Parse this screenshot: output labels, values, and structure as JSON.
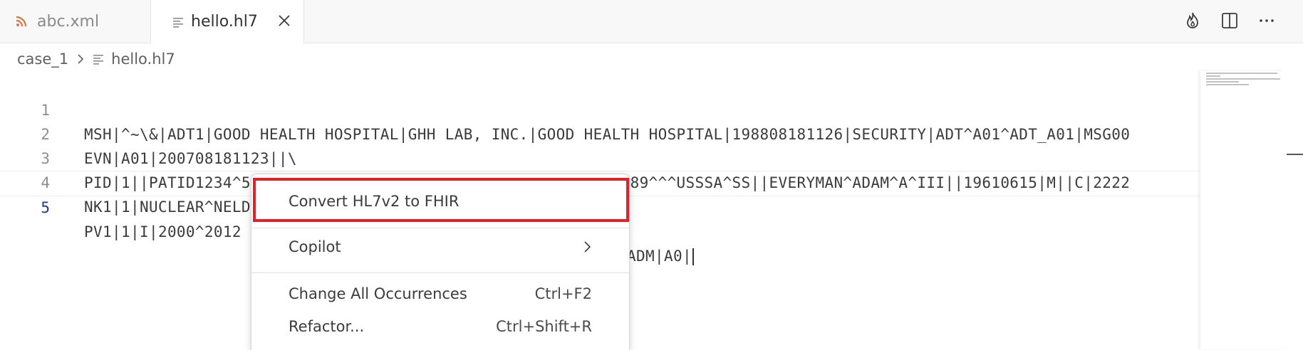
{
  "tabs": [
    {
      "label": "abc.xml",
      "icon": "rss-icon"
    },
    {
      "label": "hello.hl7",
      "icon": "lines-icon",
      "close_icon": "close-icon"
    }
  ],
  "toolbar": {
    "icons": [
      "flame-icon",
      "split-editor-icon",
      "more-actions-icon"
    ]
  },
  "breadcrumb": {
    "folder": "case_1",
    "file": "hello.hl7"
  },
  "editor": {
    "lines": [
      {
        "number": "1",
        "text": "MSH|^~\\&|ADT1|GOOD HEALTH HOSPITAL|GHH LAB, INC.|GOOD HEALTH HOSPITAL|198808181126|SECURITY|ADT^A01^ADT_A01|MSG00"
      },
      {
        "number": "2",
        "text": "EVN|A01|200708181123||\\"
      },
      {
        "number": "3",
        "text": "PID|1||PATID1234^5^M11^ADT1^MR^GOOD HEALTH HOSPITAL~123456789^^^USSSA^SS||EVERYMAN^ADAM^A^III||19610615|M||C|2222"
      },
      {
        "number": "4",
        "text": "NK1|1|NUCLEAR^NELDA^W|SP    O^SPOUSE||||NK^NEXT OF KIN"
      },
      {
        "number": "5",
        "text": "PV1|1|I|2000^2012",
        "text_tail": "ADM|A0|"
      }
    ]
  },
  "context_menu": {
    "items": [
      {
        "label": "Convert HL7v2 to FHIR",
        "shortcut": ""
      },
      {
        "label": "Copilot",
        "shortcut": "",
        "submenu_icon": "chevron-right-icon"
      },
      {
        "label": "Change All Occurrences",
        "shortcut": "Ctrl+F2"
      },
      {
        "label": "Refactor...",
        "shortcut": "Ctrl+Shift+R"
      }
    ],
    "highlight_color": "#e0202a"
  }
}
